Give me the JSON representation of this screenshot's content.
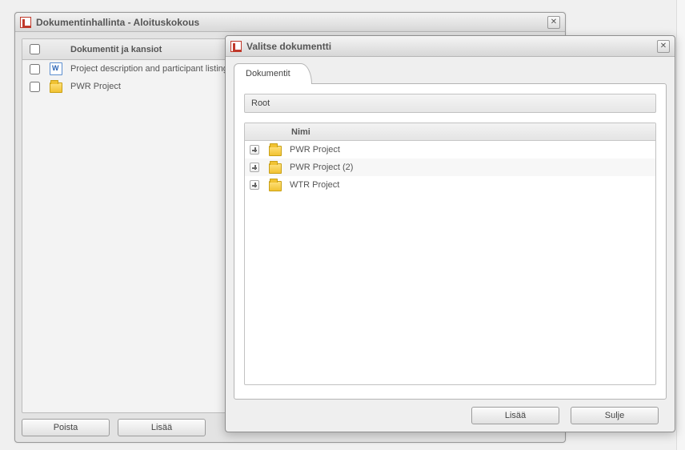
{
  "back_window": {
    "title": "Dokumentinhallinta - Aloituskokous",
    "columns": {
      "name": "Dokumentit ja kansiot"
    },
    "rows": [
      {
        "icon": "word",
        "name": "Project description and participant listing"
      },
      {
        "icon": "folder",
        "name": "PWR Project"
      }
    ],
    "buttons": {
      "delete": "Poista",
      "add": "Lisää"
    }
  },
  "modal": {
    "title": "Valitse dokumentti",
    "tab_label": "Dokumentit",
    "breadcrumb": "Root",
    "column_name": "Nimi",
    "items": [
      {
        "name": "PWR Project"
      },
      {
        "name": "PWR Project (2)"
      },
      {
        "name": "WTR Project"
      }
    ],
    "buttons": {
      "add": "Lisää",
      "close": "Sulje"
    }
  }
}
